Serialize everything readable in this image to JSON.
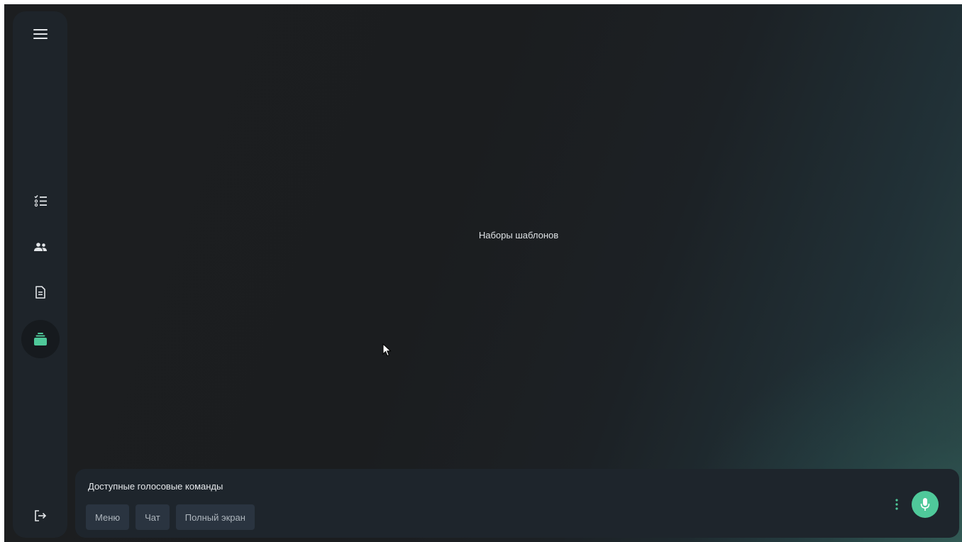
{
  "sidebar": {
    "items": [
      {
        "icon": "menu-icon"
      },
      {
        "icon": "checklist-icon"
      },
      {
        "icon": "users-icon"
      },
      {
        "icon": "document-icon"
      },
      {
        "icon": "template-stack-icon",
        "active": true
      },
      {
        "icon": "logout-icon"
      }
    ],
    "accent_color": "#4fc99a"
  },
  "main": {
    "title": "Наборы шаблонов"
  },
  "voice_commands": {
    "title": "Доступные голосовые команды",
    "commands": [
      "Меню",
      "Чат",
      "Полный экран"
    ],
    "more_icon": "vertical-dots-icon",
    "mic_icon": "microphone-icon",
    "mic_color": "#4fc99a"
  }
}
